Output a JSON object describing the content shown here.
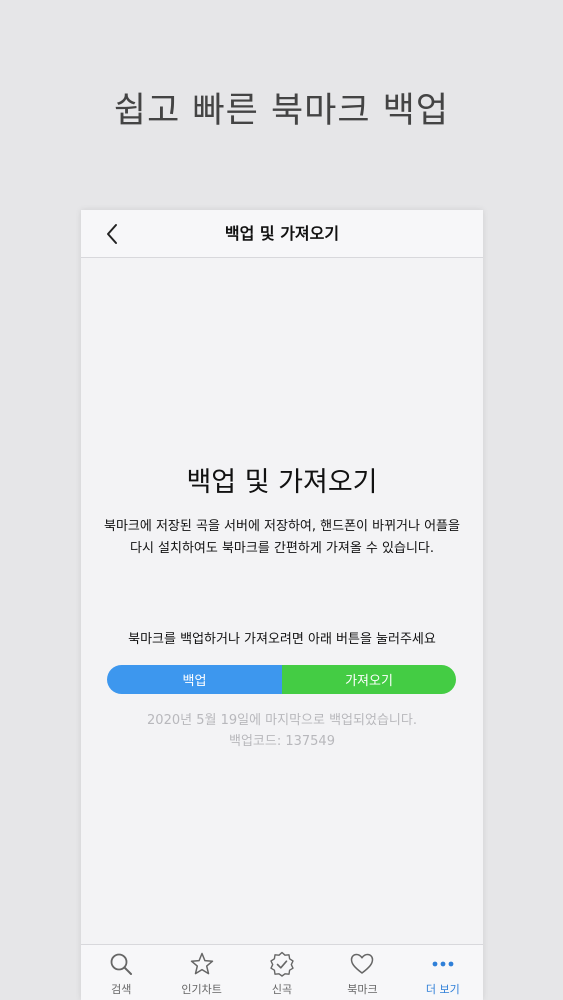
{
  "promo": {
    "headline": "쉽고 빠른 북마크 백업"
  },
  "navbar": {
    "title": "백업 및 가져오기"
  },
  "content": {
    "title": "백업 및 가져오기",
    "description": "북마크에 저장된 곡을 서버에 저장하여, 핸드폰이 바뀌거나 어플을 다시 설치하여도 북마크를 간편하게 가져올 수 있습니다.",
    "instruction": "북마크를 백업하거나 가져오려면 아래 버튼을 눌러주세요",
    "backup_button": "백업",
    "import_button": "가져오기",
    "last_backup": "2020년 5월 19일에 마지막으로 백업되었습니다.",
    "backup_code": "백업코드: 137549"
  },
  "tabbar": {
    "items": [
      {
        "label": "검색",
        "icon": "search-icon"
      },
      {
        "label": "인기차트",
        "icon": "star-icon"
      },
      {
        "label": "신곡",
        "icon": "badge-check-icon"
      },
      {
        "label": "북마크",
        "icon": "heart-icon"
      },
      {
        "label": "더 보기",
        "icon": "more-icon"
      }
    ],
    "active_index": 4
  },
  "colors": {
    "background": "#e6e6e8",
    "backup_button": "#3d97ee",
    "import_button": "#44cc44",
    "active_tab": "#2f7fd8",
    "status_text": "#b8b8bc"
  }
}
